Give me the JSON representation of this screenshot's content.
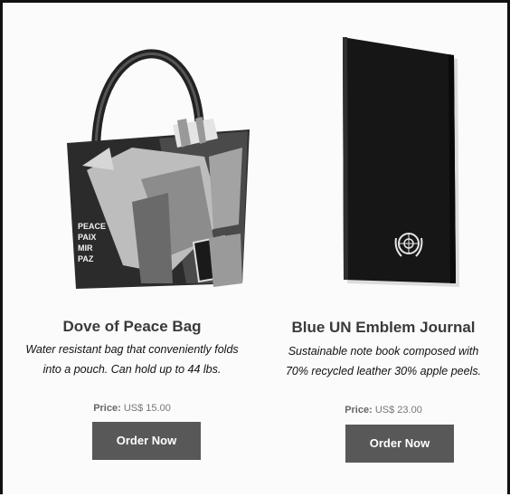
{
  "products": [
    {
      "title": "Dove of Peace Bag",
      "description_line1": "Water resistant bag that conveniently folds",
      "description_line2": "into a pouch. Can hold up to 44 lbs.",
      "price_label": "Price:",
      "price_value": "US$ 15.00",
      "button_label": "Order Now",
      "bag_text": [
        "PEACE",
        "PAIX",
        "MIR",
        "PAZ"
      ]
    },
    {
      "title": "Blue UN Emblem Journal",
      "description_line1": "Sustainable note book composed with",
      "description_line2": "70% recycled leather 30% apple peels.",
      "price_label": "Price:",
      "price_value": "US$ 23.00",
      "button_label": "Order Now"
    }
  ],
  "colors": {
    "button_bg": "#585858",
    "button_text": "#ffffff",
    "title_text": "#3a3a3a",
    "journal_cover": "#161616"
  }
}
